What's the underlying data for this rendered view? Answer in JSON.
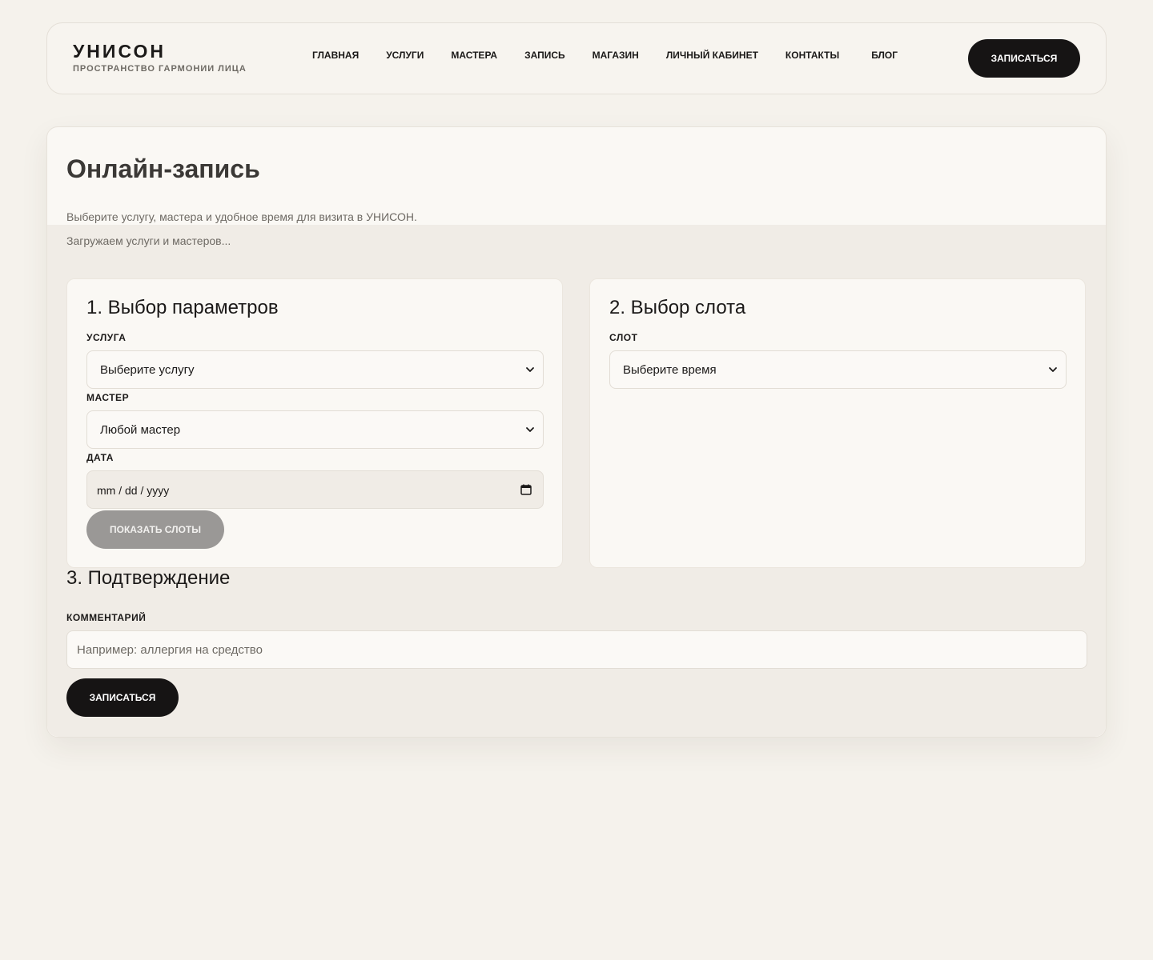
{
  "brand": {
    "title": "УНИСОН",
    "subtitle": "ПРОСТРАНСТВО ГАРМОНИИ ЛИЦА"
  },
  "nav": {
    "items": [
      {
        "label": "ГЛАВНАЯ"
      },
      {
        "label": "УСЛУГИ"
      },
      {
        "label": "МАСТЕРА"
      },
      {
        "label": "ЗАПИСЬ"
      },
      {
        "label": "МАГАЗИН"
      },
      {
        "label": "ЛИЧНЫЙ КАБИНЕТ"
      },
      {
        "label": "КОНТАКТЫ"
      },
      {
        "label": "БЛОГ"
      }
    ],
    "cta_label": "ЗАПИСАТЬСЯ"
  },
  "page": {
    "title": "Онлайн-запись",
    "description": "Выберите услугу, мастера и удобное время для визита в УНИСОН.",
    "loading": "Загружаем услуги и мастеров..."
  },
  "step1": {
    "title": "1. Выбор параметров",
    "service": {
      "label": "УСЛУГА",
      "value": "Выберите услугу"
    },
    "master": {
      "label": "МАСТЕР",
      "value": "Любой мастер"
    },
    "date": {
      "label": "ДАТА",
      "placeholder": "mm / dd / yyyy"
    },
    "show_slots_label": "ПОКАЗАТЬ СЛОТЫ"
  },
  "step2": {
    "title": "2. Выбор слота",
    "slot": {
      "label": "СЛОТ",
      "value": "Выберите время"
    }
  },
  "step3": {
    "title": "3. Подтверждение",
    "comment": {
      "label": "КОММЕНТАРИЙ",
      "placeholder": "Например: аллергия на средство"
    },
    "submit_label": "ЗАПИСАТЬСЯ"
  },
  "icons": {
    "select_arrow": "chevron-down-icon",
    "date_picker": "calendar-icon"
  },
  "colors": {
    "background": "#f5f2ec",
    "card": "#faf8f4",
    "primary_button": "#161414",
    "disabled_button": "#9a9896",
    "text": "#1b1918",
    "muted_text": "#6e6a64"
  }
}
